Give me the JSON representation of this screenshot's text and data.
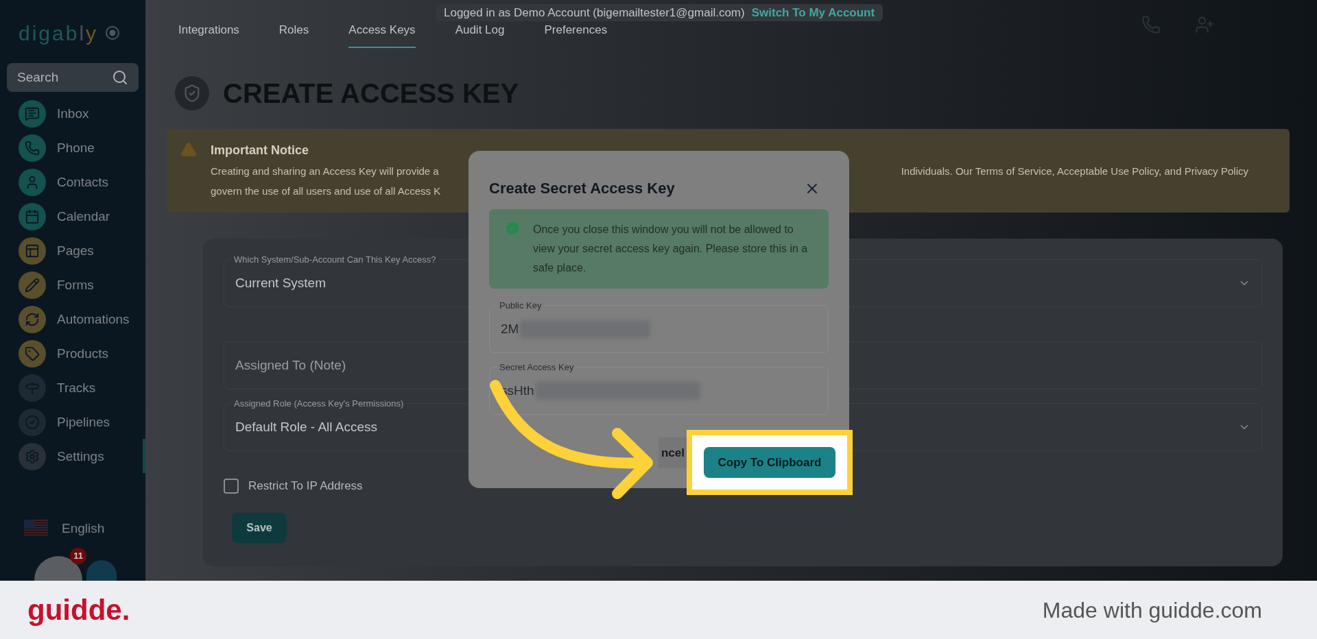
{
  "banner": {
    "text": "Logged in as Demo Account (bigemailtester1@gmail.com)",
    "link": "Switch To My Account"
  },
  "logo": {
    "text": "digably"
  },
  "search": {
    "placeholder": "Search"
  },
  "sidebar": {
    "items": [
      {
        "label": "Inbox",
        "color": "#13524f"
      },
      {
        "label": "Phone",
        "color": "#13524f"
      },
      {
        "label": "Contacts",
        "color": "#13524f"
      },
      {
        "label": "Calendar",
        "color": "#13524f"
      },
      {
        "label": "Pages",
        "color": "#5a4f2c"
      },
      {
        "label": "Forms",
        "color": "#5a4f2c"
      },
      {
        "label": "Automations",
        "color": "#5a4f2c"
      },
      {
        "label": "Products",
        "color": "#5a4f2c"
      },
      {
        "label": "Tracks",
        "color": "#1e2a33"
      },
      {
        "label": "Pipelines",
        "color": "#1e2a33"
      },
      {
        "label": "Settings",
        "color": "#2a3038"
      }
    ]
  },
  "language": "English",
  "notification_count": "11",
  "tabs": [
    {
      "label": "Integrations",
      "selected": false
    },
    {
      "label": "Roles",
      "selected": false
    },
    {
      "label": "Access Keys",
      "selected": true
    },
    {
      "label": "Audit Log",
      "selected": false
    },
    {
      "label": "Preferences",
      "selected": false
    }
  ],
  "title": "CREATE ACCESS KEY",
  "notice": {
    "title": "Important Notice",
    "line_1_start": "Creating and sharing an Access Key will provide a",
    "line_1_end": "Individuals. Our Terms of Service, Acceptable Use Policy, and Privacy Policy",
    "line_2_start": "govern the use of all users and use of all Access K"
  },
  "form": {
    "fields": [
      {
        "kind": "select",
        "label": "Which System/Sub-Account Can This Key Access?",
        "value": "Current System"
      },
      {
        "kind": "input",
        "placeholder": "Assigned To (Note)"
      },
      {
        "kind": "select",
        "label": "Assigned Role (Access Key's Permissions)",
        "value": "Default Role - All Access"
      }
    ],
    "checkbox": {
      "label": "Restrict To IP Address",
      "checked": false
    },
    "save": "Save"
  },
  "modal": {
    "title": "Create Secret Access Key",
    "alert": "Once you close this window you will not be allowed to view your secret access key again. Please store this in a safe place.",
    "fields": [
      {
        "label": "Public Key",
        "value": "2M"
      },
      {
        "label": "Secret Access Key",
        "value": "ssHth"
      }
    ],
    "cancel": "ncel",
    "copy": "Copy To Clipboard"
  },
  "footer": {
    "brand": "guidde.",
    "tagline": "Made with guidde.com"
  }
}
